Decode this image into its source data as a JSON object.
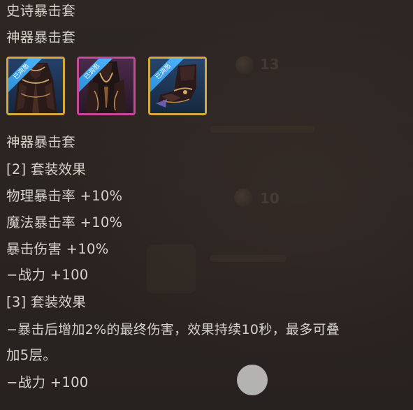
{
  "tooltip": {
    "header_lines": [
      "史诗暴击套",
      "神器暴击套"
    ],
    "items": [
      {
        "name": "robe-armor",
        "badge": "已洞悉",
        "rarity_color": "#d7a93b"
      },
      {
        "name": "cloak-armor",
        "badge": "已洞悉",
        "rarity_color": "#c54a95"
      },
      {
        "name": "boots",
        "badge": "已洞悉",
        "rarity_color": "#d7a93b"
      }
    ],
    "set_name": "神器暴击套",
    "set2_title": "[2] 套装效果",
    "set2_effects": [
      "物理暴击率 +10%",
      "魔法暴击率 +10%",
      "暴击伤害 +10%",
      "−战力 +100"
    ],
    "set3_title": "[3] 套装效果",
    "set3_effect_lines": [
      "−暴击后增加2%的最终伤害，效果持续10秒，最多可叠",
      "加5层。"
    ],
    "set3_power": "−战力 +100"
  },
  "colors": {
    "background": "#2a2320",
    "text": "#d6d1cb",
    "badge_blue": "#3aa2ee",
    "legendary_gold": "#d7a93b",
    "epic_pink": "#c54a95"
  }
}
